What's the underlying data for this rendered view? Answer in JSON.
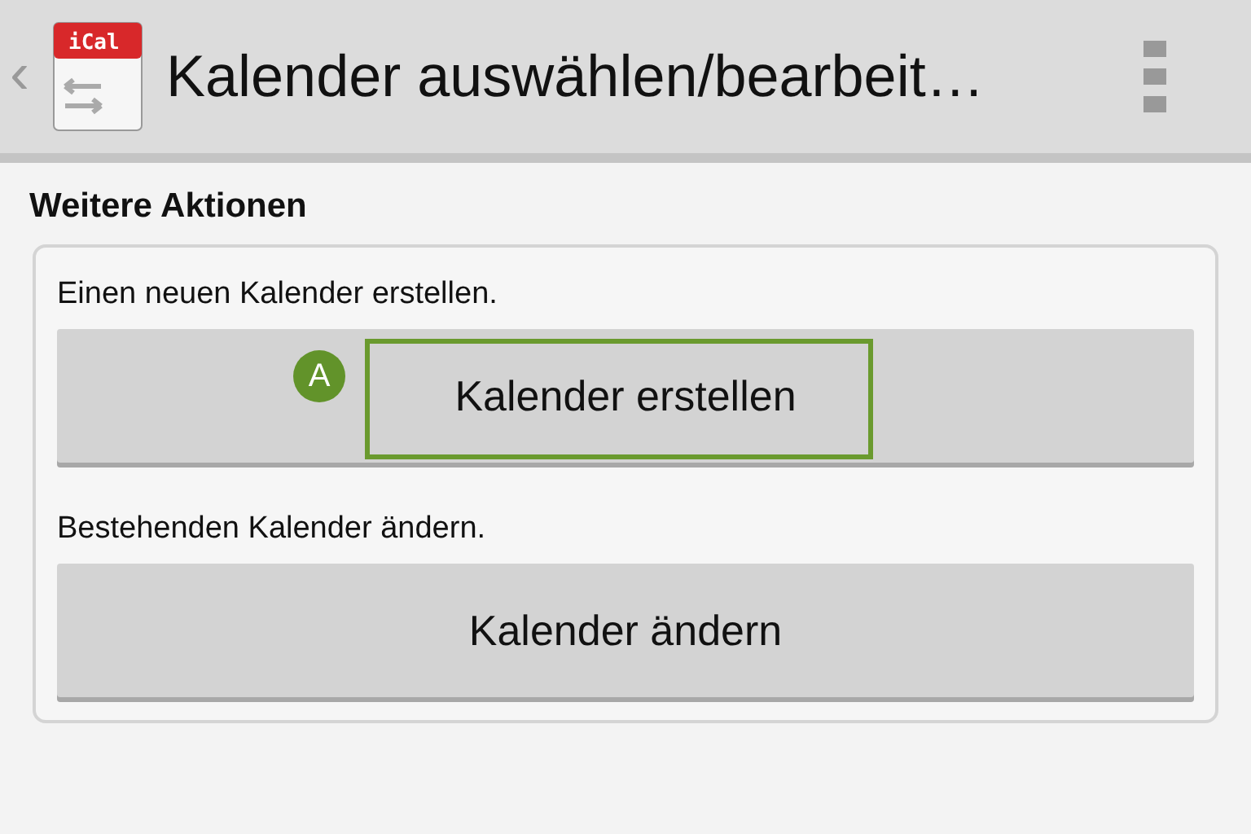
{
  "app_bar": {
    "back": "‹",
    "icon_label": "iCal",
    "title": "Kalender auswählen/bearbeit…"
  },
  "section": {
    "title": "Weitere Aktionen",
    "actions": [
      {
        "description": "Einen neuen Kalender erstellen.",
        "button": "Kalender erstellen",
        "highlighted": true,
        "callout": "A"
      },
      {
        "description": "Bestehenden Kalender ändern.",
        "button": "Kalender ändern",
        "highlighted": false
      }
    ]
  }
}
